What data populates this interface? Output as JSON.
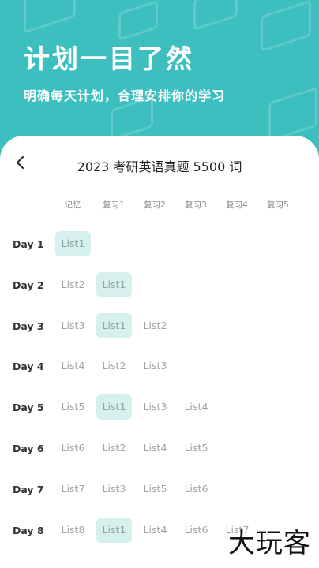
{
  "hero": {
    "title": "计划一目了然",
    "subtitle": "明确每天计划，合理安排你的学习"
  },
  "card": {
    "title": "2023 考研英语真题 5500 词",
    "back_icon": "chevron-left-icon"
  },
  "columns": [
    "记忆",
    "复习1",
    "复习2",
    "复习3",
    "复习4",
    "复习5"
  ],
  "rows": [
    {
      "day": "Day 1",
      "cells": [
        "List1",
        "",
        "",
        "",
        "",
        ""
      ],
      "highlight": [
        0
      ]
    },
    {
      "day": "Day 2",
      "cells": [
        "List2",
        "List1",
        "",
        "",
        "",
        ""
      ],
      "highlight": [
        1
      ]
    },
    {
      "day": "Day 3",
      "cells": [
        "List3",
        "List1",
        "List2",
        "",
        "",
        ""
      ],
      "highlight": [
        1
      ]
    },
    {
      "day": "Day 4",
      "cells": [
        "List4",
        "List2",
        "List3",
        "",
        "",
        ""
      ],
      "highlight": []
    },
    {
      "day": "Day 5",
      "cells": [
        "List5",
        "List1",
        "List3",
        "List4",
        "",
        ""
      ],
      "highlight": [
        1
      ]
    },
    {
      "day": "Day 6",
      "cells": [
        "List6",
        "List2",
        "List4",
        "List5",
        "",
        ""
      ],
      "highlight": []
    },
    {
      "day": "Day 7",
      "cells": [
        "List7",
        "List3",
        "List5",
        "List6",
        "",
        ""
      ],
      "highlight": []
    },
    {
      "day": "Day 8",
      "cells": [
        "List8",
        "List1",
        "List4",
        "List6",
        "List7",
        ""
      ],
      "highlight": [
        1
      ]
    }
  ],
  "watermark": "大玩客",
  "colors": {
    "hero_bg": "#3dbfbf",
    "highlight_bg": "#d6f0ee",
    "cell_text": "#a3a3a3"
  }
}
